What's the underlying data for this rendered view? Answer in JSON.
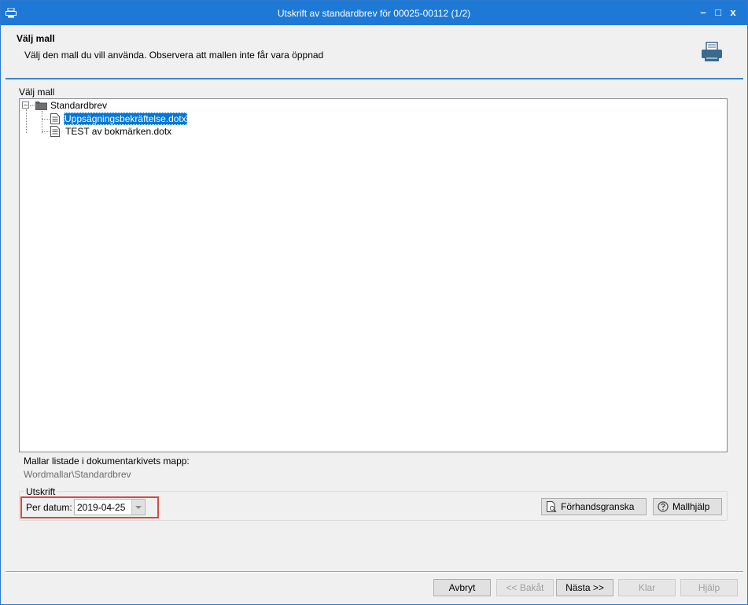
{
  "window": {
    "title": "Utskrift av standardbrev för 00025-00112 (1/2)",
    "controls": {
      "minimize": "–",
      "maximize": "□",
      "close": "x"
    }
  },
  "header": {
    "title": "Välj mall",
    "description": "Välj den mall du vill använda. Observera att mallen inte får vara öppnad",
    "icon": "printer-icon"
  },
  "template_group": {
    "label": "Välj mall",
    "tree": {
      "root": {
        "label": "Standardbrev",
        "expander": "–",
        "icon": "folder-icon"
      },
      "children": [
        {
          "label": "Uppsägningsbekräftelse.dotx",
          "selected": true,
          "icon": "document-icon"
        },
        {
          "label": "TEST av bokmärken.dotx",
          "selected": false,
          "icon": "document-icon"
        }
      ]
    }
  },
  "info": {
    "label": "Mallar listade i dokumentarkivets mapp:",
    "path": "Wordmallar\\Standardbrev"
  },
  "print_section": {
    "legend": "Utskrift",
    "date_label": "Per datum:",
    "date_value": "2019-04-25",
    "preview_button": "Förhandsgranska",
    "help_button": "Mallhjälp"
  },
  "footer": {
    "cancel": "Avbryt",
    "back": "<< Bakåt",
    "next": "Nästa >>",
    "finish": "Klar",
    "help": "Hjälp"
  },
  "colors": {
    "titlebar": "#1e79d6",
    "selection": "#0078d7",
    "highlight_border": "#d9493f",
    "header_line": "#3a86c8"
  }
}
